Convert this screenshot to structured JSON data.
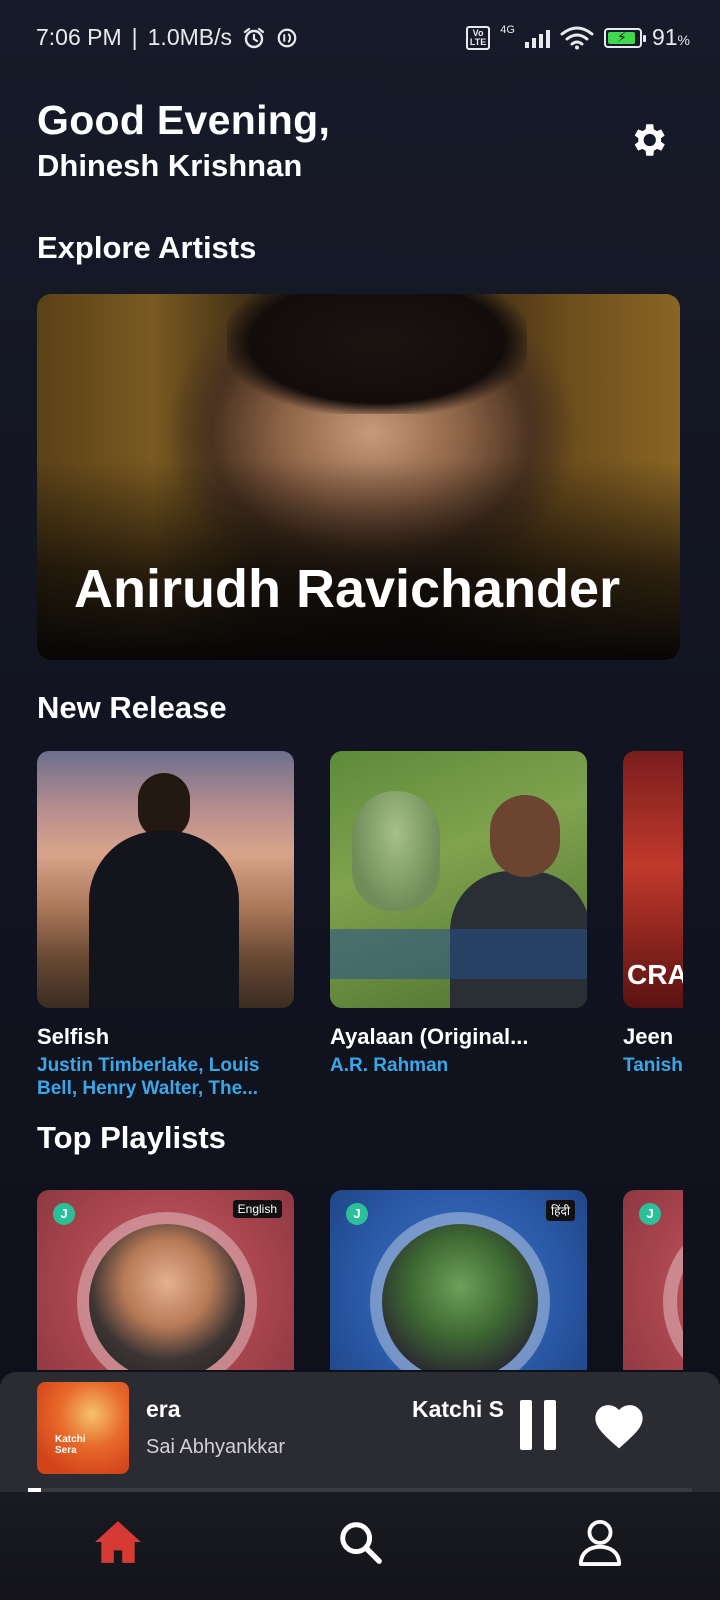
{
  "status_bar": {
    "time": "7:06 PM",
    "separator": "|",
    "speed": "1.0MB/s",
    "volte_top": "Vo",
    "volte_bottom": "LTE",
    "network": "4G",
    "battery": "91",
    "battery_unit": "%",
    "battery_level": 0.91
  },
  "header": {
    "greeting": "Good Evening,",
    "user_name": "Dhinesh Krishnan",
    "settings_icon": "gear-icon"
  },
  "explore_artists": {
    "title": "Explore Artists",
    "artist_name": "Anirudh Ravichander"
  },
  "new_release": {
    "title": "New Release",
    "items": [
      {
        "title": "Selfish",
        "artist": "Justin Timberlake, Louis Bell, Henry Walter, The..."
      },
      {
        "title": "Ayalaan (Original...",
        "artist": "A.R. Rahman"
      },
      {
        "title": "Jeen",
        "artist": "Tanish Mishr",
        "cover_text": "CRAK"
      }
    ]
  },
  "top_playlists": {
    "title": "Top Playlists",
    "items": [
      {
        "lang_tag": "English",
        "badge": "J"
      },
      {
        "lang_tag": "हिंदी",
        "badge": "J"
      },
      {
        "lang_tag": "",
        "badge": "J"
      }
    ]
  },
  "mini_player": {
    "title_part1": "era",
    "title_part2": "Katchi S",
    "artist": "Sai Abhyankkar",
    "art_text": "Katchi Sera",
    "progress": 0.02,
    "pause_icon": "pause-icon",
    "heart_icon": "heart-icon"
  },
  "bottom_nav": {
    "items": [
      {
        "icon": "home-icon",
        "active": true
      },
      {
        "icon": "search-icon",
        "active": false
      },
      {
        "icon": "profile-icon",
        "active": false
      }
    ],
    "active_color": "#d63a35"
  },
  "colors": {
    "background": "#13141f",
    "link_blue": "#3aa8e8",
    "player_bg": "#2b2c31"
  }
}
